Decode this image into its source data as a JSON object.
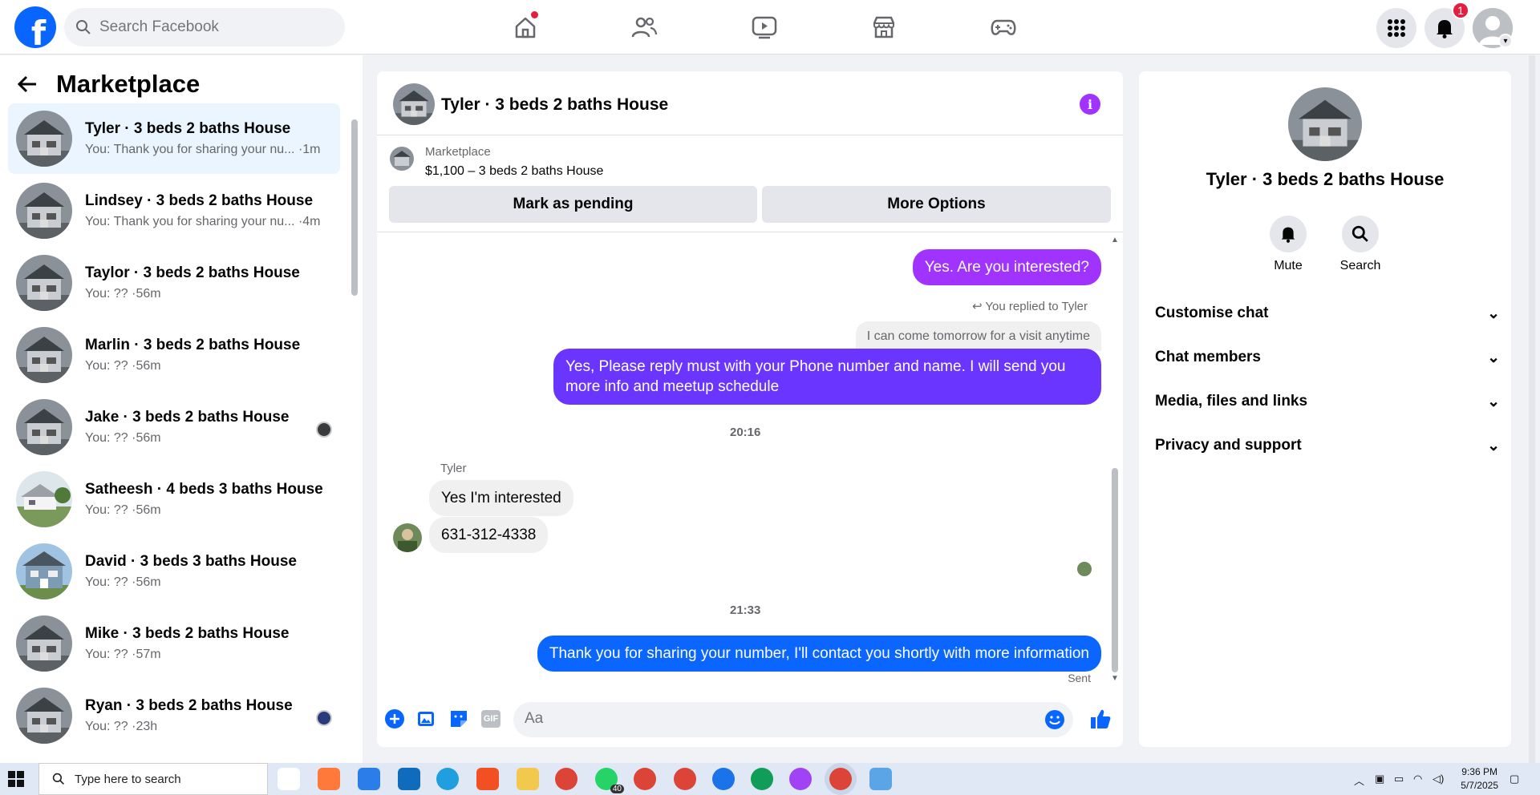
{
  "topbar": {
    "search_placeholder": "Search Facebook",
    "notification_count": "1"
  },
  "sidebar": {
    "title": "Marketplace",
    "conversations": [
      {
        "name": "Tyler · 3 beds 2 baths House",
        "preview": "You: Thank you for sharing your nu... ·1m",
        "active": true
      },
      {
        "name": "Lindsey · 3 beds 2 baths House",
        "preview": "You: Thank you for sharing your nu... ·4m"
      },
      {
        "name": "Taylor · 3 beds 2 baths House",
        "preview": "You: ?? ·56m"
      },
      {
        "name": "Marlin · 3 beds 2 baths House",
        "preview": "You: ?? ·56m"
      },
      {
        "name": "Jake · 3 beds 2 baths House",
        "preview": "You: ?? ·56m"
      },
      {
        "name": "Satheesh · 4 beds 3 baths House",
        "preview": "You: ?? ·56m"
      },
      {
        "name": "David · 3 beds 3 baths House",
        "preview": "You: ?? ·56m"
      },
      {
        "name": "Mike · 3 beds 2 baths House",
        "preview": "You: ?? ·57m"
      },
      {
        "name": "Ryan · 3 beds 2 baths House",
        "preview": "You: ?? ·23h"
      }
    ]
  },
  "chat": {
    "title": "Tyler · 3 beds 2 baths House",
    "marketplace_label": "Marketplace",
    "listing": "$1,100 – 3 beds 2 baths House",
    "mark_pending": "Mark as pending",
    "more_options": "More Options",
    "messages": {
      "m1": "Yes. Are you interested?",
      "replied_to": "You replied to Tyler",
      "quoted": "I can come tomorrow for a visit anytime",
      "m2": "Yes, Please reply must with your Phone number and name. I will send you more info and meetup schedule",
      "time1": "20:16",
      "sender": "Tyler",
      "m3": "Yes I'm interested",
      "m4": "631-312-4338",
      "time2": "21:33",
      "m5": "Thank you for sharing your number, I'll contact you shortly with more information",
      "status": "Sent"
    },
    "composer_placeholder": "Aa",
    "gif_label": "GIF"
  },
  "details": {
    "name": "Tyler · 3 beds 2 baths House",
    "mute": "Mute",
    "search": "Search",
    "sections": [
      "Customise chat",
      "Chat members",
      "Media, files and links",
      "Privacy and support"
    ]
  },
  "taskbar": {
    "search_placeholder": "Type here to search",
    "time": "9:36 PM",
    "date": "5/7/2025",
    "whatsapp_badge": "40"
  },
  "colors": {
    "brand": "#0866ff",
    "purple_bubble": "#a033ff",
    "violet_bubble": "#6a35ff",
    "blue_bubble": "#0a66ff"
  }
}
